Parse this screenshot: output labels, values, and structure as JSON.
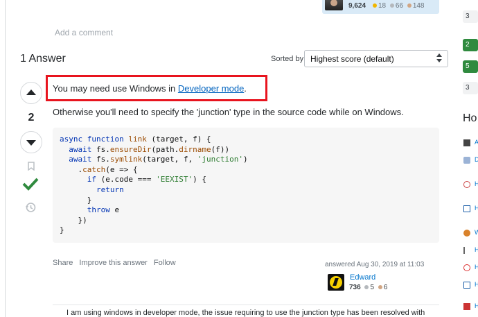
{
  "question_owner_card": {
    "reputation": "9,624",
    "gold": "18",
    "silver": "66",
    "bronze": "148"
  },
  "add_comment": "Add a comment",
  "answers": {
    "title": "1 Answer",
    "sorted_by_label": "Sorted by:",
    "sort_value": "Highest score (default)"
  },
  "answer": {
    "score": "2",
    "text_prefix": "You may need use Windows in ",
    "link_text": "Developer mode",
    "text_suffix": ".",
    "paragraph2": "Otherwise you'll need to specify the 'junction' type in the source code while on Windows.",
    "code_lines": [
      "async function link (target, f) {",
      "  await fs.ensureDir(path.dirname(f))",
      "  await fs.symlink(target, f, 'junction')",
      "    .catch(e => {",
      "      if (e.code === 'EEXIST') {",
      "        return",
      "      }",
      "      throw e",
      "    })",
      "}"
    ],
    "actions": {
      "share": "Share",
      "improve": "Improve this answer",
      "follow": "Follow"
    },
    "answered_text": "answered Aug 30, 2019 at 11:03",
    "user_name": "Edward",
    "user_rep": "736",
    "user_silver": "5",
    "user_bronze": "6"
  },
  "comment": {
    "text": "I am using windows in developer mode, the issue requiring to use the junction type has been resolved with"
  },
  "sidebar": {
    "counts": [
      {
        "value": "3",
        "style": "grey"
      },
      {
        "value": "2",
        "style": "green"
      },
      {
        "value": "5",
        "style": "green"
      },
      {
        "value": "3",
        "style": "grey"
      }
    ],
    "hot_title": "Ho",
    "links": [
      "A",
      "D",
      "H",
      "H",
      "W",
      "H",
      "H",
      "H",
      "H",
      "H"
    ]
  }
}
